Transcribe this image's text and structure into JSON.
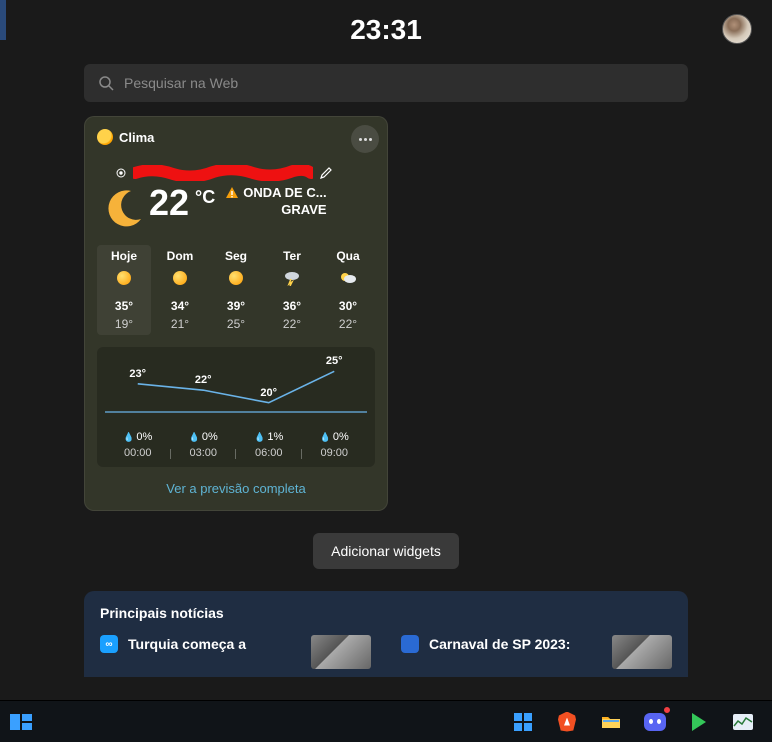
{
  "header": {
    "clock": "23:31"
  },
  "search": {
    "placeholder": "Pesquisar na Web"
  },
  "weather": {
    "card_title": "Clima",
    "current": {
      "temp": "22",
      "unit": "°C",
      "alert_line1": "ONDA DE C...",
      "alert_line2": "GRAVE"
    },
    "days": [
      {
        "label": "Hoje",
        "icon": "sun",
        "hi": "35°",
        "lo": "19°"
      },
      {
        "label": "Dom",
        "icon": "sun",
        "hi": "34°",
        "lo": "21°"
      },
      {
        "label": "Seg",
        "icon": "sun",
        "hi": "39°",
        "lo": "25°"
      },
      {
        "label": "Ter",
        "icon": "storm",
        "hi": "36°",
        "lo": "22°"
      },
      {
        "label": "Qua",
        "icon": "partly-cloudy",
        "hi": "30°",
        "lo": "22°"
      }
    ],
    "hourly": [
      {
        "time": "00:00",
        "temp": "23°",
        "precip": "0%"
      },
      {
        "time": "03:00",
        "temp": "22°",
        "precip": "0%"
      },
      {
        "time": "06:00",
        "temp": "20°",
        "precip": "1%"
      },
      {
        "time": "09:00",
        "temp": "25°",
        "precip": "0%"
      }
    ],
    "full_forecast_label": "Ver a previsão completa"
  },
  "add_widgets_label": "Adicionar widgets",
  "news": {
    "section_title": "Principais notícias",
    "items": [
      {
        "badge_color": "#1aa0ff",
        "badge_text": "∞",
        "headline": "Turquia começa a"
      },
      {
        "badge_color": "#2a6ad4",
        "badge_text": "",
        "headline": "Carnaval de SP 2023:"
      }
    ]
  },
  "taskbar": {
    "left": [
      {
        "name": "widgets"
      }
    ],
    "right": [
      {
        "name": "start"
      },
      {
        "name": "brave"
      },
      {
        "name": "file-explorer"
      },
      {
        "name": "discord"
      },
      {
        "name": "play"
      },
      {
        "name": "task-manager"
      }
    ]
  },
  "chart_data": {
    "type": "line",
    "title": "Hourly temperature",
    "x": [
      "00:00",
      "03:00",
      "06:00",
      "09:00"
    ],
    "series": [
      {
        "name": "Temperature (°)",
        "values": [
          23,
          22,
          20,
          25
        ]
      },
      {
        "name": "Precipitation (%)",
        "values": [
          0,
          0,
          1,
          0
        ]
      }
    ],
    "xlabel": "",
    "ylabel": "",
    "ylim": [
      18,
      27
    ]
  }
}
